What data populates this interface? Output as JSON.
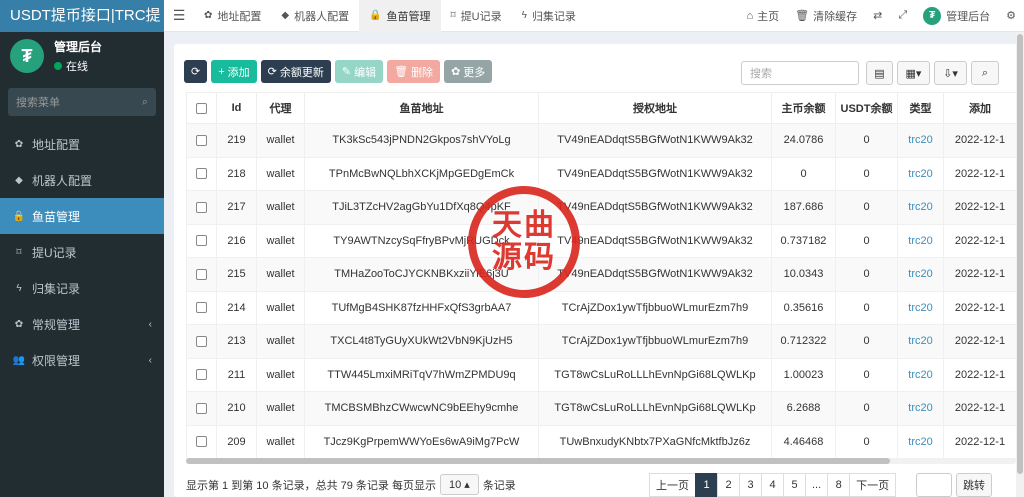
{
  "app_title": "USDT提币接口|TRC提",
  "user": {
    "name": "管理后台",
    "status": "在线",
    "logo_glyph": "₮"
  },
  "sidebar": {
    "search_placeholder": "搜索菜单",
    "items": [
      {
        "label": "地址配置",
        "icon": "gear-icon",
        "glyph": "✿"
      },
      {
        "label": "机器人配置",
        "icon": "android-icon",
        "glyph": "◆"
      },
      {
        "label": "鱼苗管理",
        "icon": "lock-icon",
        "glyph": "🔒",
        "active": true
      },
      {
        "label": "提U记录",
        "icon": "bookmark-icon",
        "glyph": "⌑"
      },
      {
        "label": "归集记录",
        "icon": "bolt-icon",
        "glyph": "ϟ"
      },
      {
        "label": "常规管理",
        "icon": "cogs-icon",
        "glyph": "✿",
        "caret": "‹"
      },
      {
        "label": "权限管理",
        "icon": "users-icon",
        "glyph": "👥",
        "caret": "‹"
      }
    ]
  },
  "header": {
    "tabs": [
      {
        "label": "地址配置",
        "glyph": "✿"
      },
      {
        "label": "机器人配置",
        "glyph": "◆"
      },
      {
        "label": "鱼苗管理",
        "glyph": "🔒",
        "active": true
      },
      {
        "label": "提U记录",
        "glyph": "⌑"
      },
      {
        "label": "归集记录",
        "glyph": "ϟ"
      }
    ],
    "right": {
      "home": "主页",
      "clear_cache": "清除缓存",
      "admin": "管理后台"
    }
  },
  "toolbar": {
    "refresh": "⟳",
    "add": "添加",
    "balance_update": "余额更新",
    "edit": "编辑",
    "delete": "删除",
    "more": "更多",
    "search_placeholder": "搜索"
  },
  "table": {
    "columns": [
      "Id",
      "代理",
      "鱼苗地址",
      "授权地址",
      "主币余额",
      "USDT余额",
      "类型",
      "添加"
    ],
    "rows": [
      {
        "id": "219",
        "agent": "wallet",
        "fish": "TK3kSc543jPNDN2Gkpos7shVYoLg",
        "auth": "TV49nEADdqtS5BGfWotN1KWW9Ak32",
        "main": "24.0786",
        "usdt": "0",
        "type": "trc20",
        "date": "2022-12-1"
      },
      {
        "id": "218",
        "agent": "wallet",
        "fish": "TPnMcBwNQLbhXCKjMpGEDgEmCk",
        "auth": "TV49nEADdqtS5BGfWotN1KWW9Ak32",
        "main": "0",
        "usdt": "0",
        "type": "trc20",
        "date": "2022-12-1"
      },
      {
        "id": "217",
        "agent": "wallet",
        "fish": "TJiL3TZcHV2agGbYu1DfXq8Q4pKF",
        "auth": "TV49nEADdqtS5BGfWotN1KWW9Ak32",
        "main": "187.686",
        "usdt": "0",
        "type": "trc20",
        "date": "2022-12-1"
      },
      {
        "id": "216",
        "agent": "wallet",
        "fish": "TY9AWTNzcySqFfryBPvMjRUGDck",
        "auth": "TV49nEADdqtS5BGfWotN1KWW9Ak32",
        "main": "0.737182",
        "usdt": "0",
        "type": "trc20",
        "date": "2022-12-1"
      },
      {
        "id": "215",
        "agent": "wallet",
        "fish": "TMHaZooToCJYCKNBKxziiYiE6j3U",
        "auth": "TV49nEADdqtS5BGfWotN1KWW9Ak32",
        "main": "10.0343",
        "usdt": "0",
        "type": "trc20",
        "date": "2022-12-1"
      },
      {
        "id": "214",
        "agent": "wallet",
        "fish": "TUfMgB4SHK87fzHHFxQfS3grbAA7",
        "auth": "TCrAjZDox1ywTfjbbuoWLmurEzm7h9",
        "main": "0.35616",
        "usdt": "0",
        "type": "trc20",
        "date": "2022-12-1"
      },
      {
        "id": "213",
        "agent": "wallet",
        "fish": "TXCL4t8TyGUyXUkWt2VbN9KjUzH5",
        "auth": "TCrAjZDox1ywTfjbbuoWLmurEzm7h9",
        "main": "0.712322",
        "usdt": "0",
        "type": "trc20",
        "date": "2022-12-1"
      },
      {
        "id": "211",
        "agent": "wallet",
        "fish": "TTW445LmxiMRiTqV7hWmZPMDU9q",
        "auth": "TGT8wCsLuRoLLLhEvnNpGi68LQWLKp",
        "main": "1.00023",
        "usdt": "0",
        "type": "trc20",
        "date": "2022-12-1"
      },
      {
        "id": "210",
        "agent": "wallet",
        "fish": "TMCBSMBhzCWwcwNC9bEEhy9cmhe",
        "auth": "TGT8wCsLuRoLLLhEvnNpGi68LQWLKp",
        "main": "6.2688",
        "usdt": "0",
        "type": "trc20",
        "date": "2022-12-1"
      },
      {
        "id": "209",
        "agent": "wallet",
        "fish": "TJcz9KgPrpemWWYoEs6wA9iMg7PcW",
        "auth": "TUwBnxudyKNbtx7PXaGNfcMktfbJz6z",
        "main": "4.46468",
        "usdt": "0",
        "type": "trc20",
        "date": "2022-12-1"
      }
    ]
  },
  "footer": {
    "summary": "显示第 1 到第 10 条记录，总共 79 条记录 每页显示",
    "page_size": "10",
    "suffix": "条记录",
    "pages": [
      "上一页",
      "1",
      "2",
      "3",
      "4",
      "5",
      "...",
      "8",
      "下一页"
    ],
    "current_page": "1",
    "jump": "跳转"
  },
  "watermark": {
    "line1": "天曲",
    "line2": "源码"
  },
  "colors": {
    "sidebar_bg": "#222d32",
    "active_blue": "#3c8dbc",
    "btn_dark": "#2c3e50",
    "btn_green": "#18bc9c",
    "stamp_red": "#d9251c"
  }
}
